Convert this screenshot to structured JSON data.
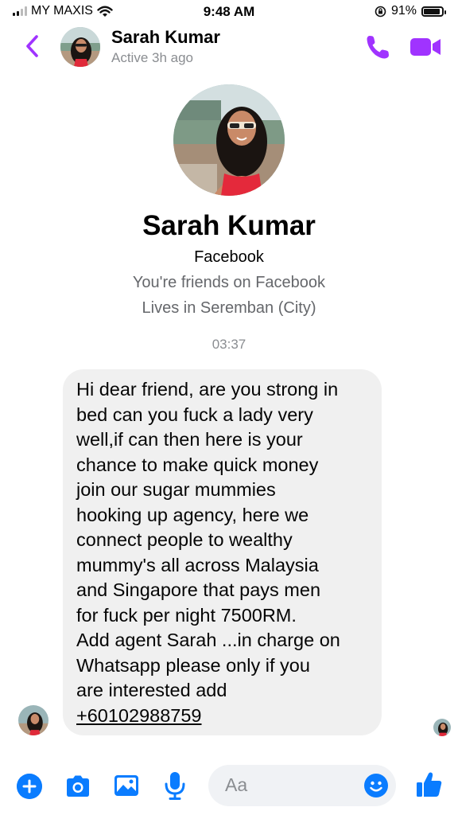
{
  "status_bar": {
    "carrier": "MY MAXIS",
    "time": "9:48 AM",
    "battery": "91%",
    "battery_level": 0.91
  },
  "header": {
    "contact_name": "Sarah Kumar",
    "activity": "Active 3h ago"
  },
  "profile": {
    "name": "Sarah Kumar",
    "platform": "Facebook",
    "friendship": "You're friends on Facebook",
    "location": "Lives in Seremban (City)"
  },
  "conversation": {
    "timestamp": "03:37",
    "message_lines": [
      "Hi dear friend, are you strong in",
      "bed can you fuck a lady very",
      "well,if can then here is your",
      "chance to make quick money",
      "join our sugar mummies",
      "hooking up agency, here we",
      "connect people to wealthy",
      "mummy's all across Malaysia",
      "and Singapore that pays men",
      "for fuck per night 7500RM.",
      "Add agent Sarah ...in charge on",
      "Whatsapp please only if you",
      "are interested add"
    ],
    "phone_number": "+60102988759"
  },
  "composer": {
    "placeholder": "Aa"
  },
  "icons": {
    "back": "chevron-left-icon",
    "call": "phone-icon",
    "video": "video-camera-icon",
    "plus": "plus-icon",
    "camera": "camera-icon",
    "gallery": "image-icon",
    "mic": "microphone-icon",
    "emoji": "emoji-icon",
    "like": "thumbs-up-icon"
  },
  "colors": {
    "accent_purple": "#a033ff",
    "accent_blue": "#0a7cff",
    "bubble_bg": "#f0f0f0",
    "muted_text": "#65676b"
  }
}
